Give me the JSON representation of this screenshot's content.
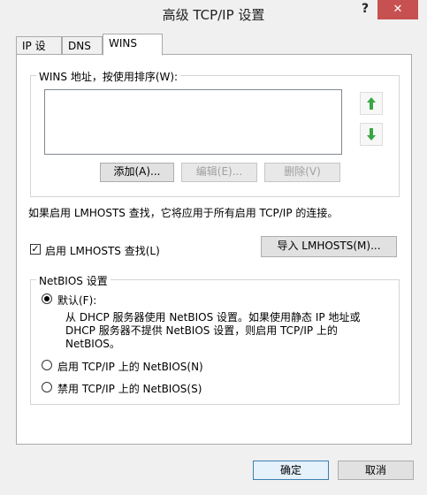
{
  "window": {
    "title": "高级 TCP/IP 设置",
    "help_label": "?",
    "close_label": "✕"
  },
  "tabs": [
    {
      "label": "IP 设置"
    },
    {
      "label": "DNS"
    },
    {
      "label": "WINS"
    }
  ],
  "wins": {
    "group_title": "WINS 地址，按使用排序(W):",
    "add_label": "添加(A)...",
    "edit_label": "编辑(E)...",
    "remove_label": "删除(V)",
    "move_up_icon": "green-up-arrow-icon",
    "move_down_icon": "green-down-arrow-icon",
    "lmhosts_info": "如果启用 LMHOSTS 查找，它将应用于所有启用 TCP/IP 的连接。",
    "lmhosts_checkbox_label": "启用 LMHOSTS 查找(L)",
    "lmhosts_checked": true,
    "import_label": "导入 LMHOSTS(M)..."
  },
  "netbios": {
    "group_title": "NetBIOS 设置",
    "options": [
      {
        "label": "默认(F):",
        "checked": true
      },
      {
        "label": "启用 TCP/IP 上的 NetBIOS(N)",
        "checked": false
      },
      {
        "label": "禁用 TCP/IP 上的 NetBIOS(S)",
        "checked": false
      }
    ],
    "default_desc": [
      "从 DHCP 服务器使用 NetBIOS 设置。如果使用静态 IP 地址或",
      "DHCP 服务器不提供 NetBIOS 设置，则启用 TCP/IP 上的",
      "NetBIOS。"
    ]
  },
  "footer": {
    "ok_label": "确定",
    "cancel_label": "取消"
  },
  "colors": {
    "close_button": "#c75050",
    "arrow_green": "#3aa544",
    "default_button_border": "#3c7fb1"
  }
}
